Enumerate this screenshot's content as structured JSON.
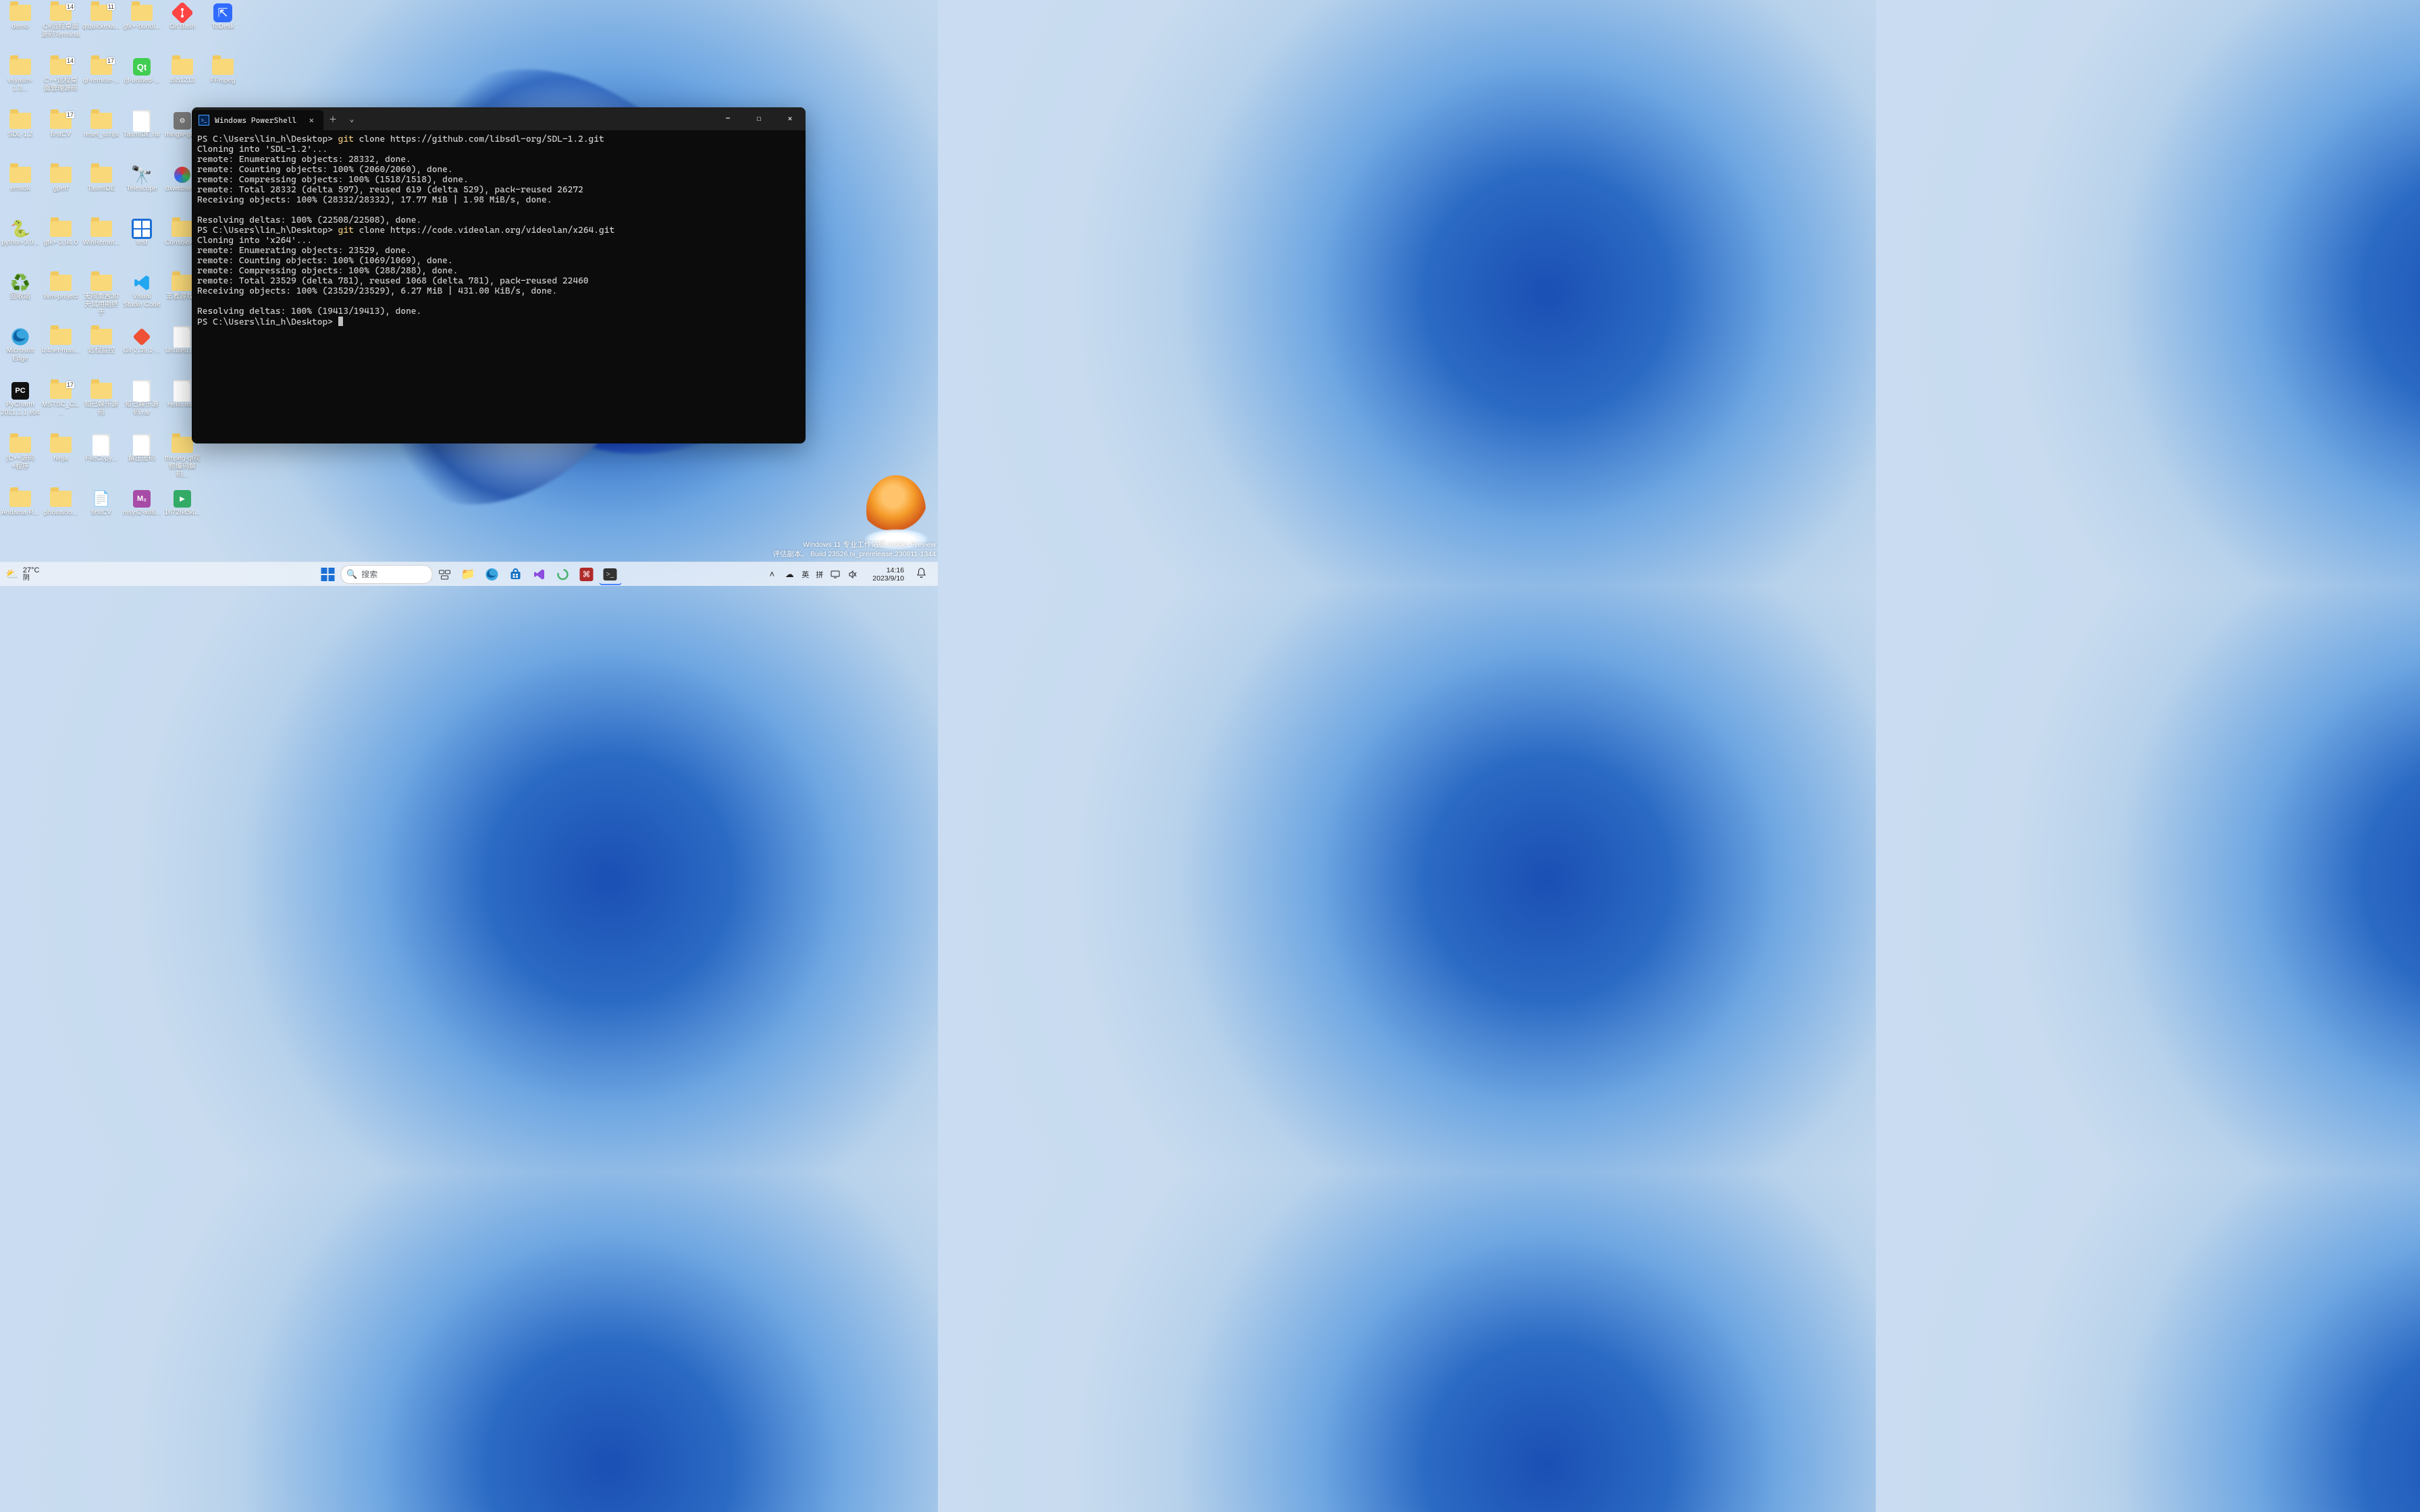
{
  "watermark": {
    "line1": "Windows 11 专业工作站版 Insider Preview",
    "line2": "评估副本。 Build 23526.ni_prerelease.230811-1344"
  },
  "desktop_icons": [
    {
      "col": 0,
      "row": 0,
      "type": "folder",
      "label": "demo"
    },
    {
      "col": 1,
      "row": 0,
      "type": "folder",
      "label": "C#远程桌面源码Terminal",
      "badge": "14"
    },
    {
      "col": 2,
      "row": 0,
      "type": "folder",
      "label": "qtquickexa...",
      "badge": "11"
    },
    {
      "col": 3,
      "row": 0,
      "type": "folder",
      "label": "gtk+-bundl..."
    },
    {
      "col": 4,
      "row": 0,
      "type": "app",
      "label": "Git Bash",
      "icon": "git"
    },
    {
      "col": 5,
      "row": 0,
      "type": "app",
      "label": "ToDesk",
      "icon": "todesk"
    },
    {
      "col": 0,
      "row": 1,
      "type": "folder",
      "label": "vsyasm-1.3..."
    },
    {
      "col": 1,
      "row": 1,
      "type": "folder",
      "label": "C++远程桌面管理源码",
      "badge": "14"
    },
    {
      "col": 2,
      "row": 1,
      "type": "folder",
      "label": "qt-remote-...",
      "badge": "17"
    },
    {
      "col": 3,
      "row": 1,
      "type": "app",
      "label": "qt-unified-...",
      "icon": "qt"
    },
    {
      "col": 4,
      "row": 1,
      "type": "folder",
      "label": "zlib1213"
    },
    {
      "col": 5,
      "row": 1,
      "type": "folder",
      "label": "FFmpeg"
    },
    {
      "col": 0,
      "row": 2,
      "type": "folder",
      "label": "SDL-1.2"
    },
    {
      "col": 1,
      "row": 2,
      "type": "folder",
      "label": "firstCV",
      "badge": "17"
    },
    {
      "col": 2,
      "row": 2,
      "type": "folder",
      "label": "reset_script"
    },
    {
      "col": 3,
      "row": 2,
      "type": "file",
      "label": "TasmIDE.rar"
    },
    {
      "col": 4,
      "row": 2,
      "type": "app",
      "label": "mingw-ge...",
      "icon": "mingw"
    },
    {
      "col": 0,
      "row": 3,
      "type": "folder",
      "label": "emsdk"
    },
    {
      "col": 1,
      "row": 3,
      "type": "folder",
      "label": "gperf"
    },
    {
      "col": 2,
      "row": 3,
      "type": "folder",
      "label": "TasmIDE"
    },
    {
      "col": 3,
      "row": 3,
      "type": "app",
      "label": "Telescope",
      "icon": "telescope"
    },
    {
      "col": 4,
      "row": 3,
      "type": "app",
      "label": "dxwebset...",
      "icon": "dx"
    },
    {
      "col": 0,
      "row": 4,
      "type": "app",
      "label": "python-3.9...",
      "icon": "python"
    },
    {
      "col": 1,
      "row": 4,
      "type": "folder",
      "label": "gtk+-3.94.0"
    },
    {
      "col": 2,
      "row": 4,
      "type": "folder",
      "label": "WinRemot..."
    },
    {
      "col": 3,
      "row": 4,
      "type": "app",
      "label": "test",
      "icon": "win11"
    },
    {
      "col": 4,
      "row": 4,
      "type": "folder",
      "label": "ConsoleA..."
    },
    {
      "col": 0,
      "row": 5,
      "type": "app",
      "label": "回收站",
      "icon": "recycle"
    },
    {
      "col": 1,
      "row": 5,
      "type": "folder",
      "label": "llvm-project"
    },
    {
      "col": 2,
      "row": 5,
      "type": "folder",
      "label": "无限重置30天试用期终于"
    },
    {
      "col": 3,
      "row": 5,
      "type": "app",
      "label": "Visual Studio Code",
      "icon": "vscode"
    },
    {
      "col": 4,
      "row": 5,
      "type": "folder",
      "label": "王者游戏..."
    },
    {
      "col": 0,
      "row": 6,
      "type": "app",
      "label": "Microsoft Edge",
      "icon": "edge"
    },
    {
      "col": 1,
      "row": 6,
      "type": "folder",
      "label": "lz4net-mas..."
    },
    {
      "col": 2,
      "row": 6,
      "type": "folder",
      "label": "远程监控"
    },
    {
      "col": 3,
      "row": 6,
      "type": "app",
      "label": "Git-2.39.1-...",
      "icon": "gitinst"
    },
    {
      "col": 4,
      "row": 6,
      "type": "file",
      "label": "Untitled.a..."
    },
    {
      "col": 0,
      "row": 7,
      "type": "app",
      "label": "PyCharm 2021.1.1 x64",
      "icon": "pycharm"
    },
    {
      "col": 1,
      "row": 7,
      "type": "folder",
      "label": "MSTSC_CL...",
      "badge": "17"
    },
    {
      "col": 2,
      "row": 7,
      "type": "folder",
      "label": "知己娱乐源码"
    },
    {
      "col": 3,
      "row": 7,
      "type": "file",
      "label": "知己娱乐源码.rar"
    },
    {
      "col": 4,
      "row": 7,
      "type": "file",
      "label": "Hello.as..."
    },
    {
      "col": 0,
      "row": 8,
      "type": "folder",
      "label": "(C++源码+程序"
    },
    {
      "col": 1,
      "row": 8,
      "type": "folder",
      "label": "ninja"
    },
    {
      "col": 2,
      "row": 8,
      "type": "file",
      "label": "FileCopy..."
    },
    {
      "col": 3,
      "row": 8,
      "type": "file",
      "label": "解压密码"
    },
    {
      "col": 4,
      "row": 8,
      "type": "folder",
      "label": "ffmpeg-qt视频编码解码..."
    },
    {
      "col": 0,
      "row": 9,
      "type": "folder",
      "label": "Andama-R..."
    },
    {
      "col": 1,
      "row": 9,
      "type": "folder",
      "label": "photosho..."
    },
    {
      "col": 2,
      "row": 9,
      "type": "app",
      "label": "firstCV",
      "icon": "pyfile"
    },
    {
      "col": 3,
      "row": 9,
      "type": "app",
      "label": "msys2-x86...",
      "icon": "msys2"
    },
    {
      "col": 4,
      "row": 9,
      "type": "app",
      "label": "16726454...",
      "icon": "dosbox"
    }
  ],
  "terminal": {
    "tab_title": "Windows PowerShell",
    "lines": [
      {
        "segments": [
          {
            "t": "PS C:\\Users\\lin_h\\Desktop> "
          },
          {
            "t": "git ",
            "c": "y"
          },
          {
            "t": "clone https://github.com/libsdl-org/SDL-1.2.git"
          }
        ]
      },
      {
        "segments": [
          {
            "t": "Cloning into 'SDL-1.2'..."
          }
        ]
      },
      {
        "segments": [
          {
            "t": "remote: Enumerating objects: 28332, done."
          }
        ]
      },
      {
        "segments": [
          {
            "t": "remote: Counting objects: 100% (2060/2060), done."
          }
        ]
      },
      {
        "segments": [
          {
            "t": "remote: Compressing objects: 100% (1518/1518), done."
          }
        ]
      },
      {
        "segments": [
          {
            "t": "remote: Total 28332 (delta 597), reused 619 (delta 529), pack-reused 26272"
          }
        ]
      },
      {
        "segments": [
          {
            "t": "Receiving objects: 100% (28332/28332), 17.77 MiB | 1.98 MiB/s, done."
          }
        ]
      },
      {
        "segments": [
          {
            "t": ""
          }
        ]
      },
      {
        "segments": [
          {
            "t": "Resolving deltas: 100% (22508/22508), done."
          }
        ]
      },
      {
        "segments": [
          {
            "t": "PS C:\\Users\\lin_h\\Desktop> "
          },
          {
            "t": "git ",
            "c": "y"
          },
          {
            "t": "clone https://code.videolan.org/videolan/x264.git"
          }
        ]
      },
      {
        "segments": [
          {
            "t": "Cloning into 'x264'..."
          }
        ]
      },
      {
        "segments": [
          {
            "t": "remote: Enumerating objects: 23529, done."
          }
        ]
      },
      {
        "segments": [
          {
            "t": "remote: Counting objects: 100% (1069/1069), done."
          }
        ]
      },
      {
        "segments": [
          {
            "t": "remote: Compressing objects: 100% (288/288), done."
          }
        ]
      },
      {
        "segments": [
          {
            "t": "remote: Total 23529 (delta 781), reused 1068 (delta 781), pack-reused 22460"
          }
        ]
      },
      {
        "segments": [
          {
            "t": "Receiving objects: 100% (23529/23529), 6.27 MiB | 431.00 KiB/s, done."
          }
        ]
      },
      {
        "segments": [
          {
            "t": ""
          }
        ]
      },
      {
        "segments": [
          {
            "t": "Resolving deltas: 100% (19413/19413), done."
          }
        ]
      },
      {
        "segments": [
          {
            "t": "PS C:\\Users\\lin_h\\Desktop> "
          }
        ],
        "cursor": true
      }
    ]
  },
  "taskbar": {
    "weather_temp": "27°C",
    "weather_desc": "阴",
    "search_placeholder": "搜索",
    "ime1": "英",
    "ime2": "拼",
    "time": "14:16",
    "date": "2023/9/10"
  }
}
